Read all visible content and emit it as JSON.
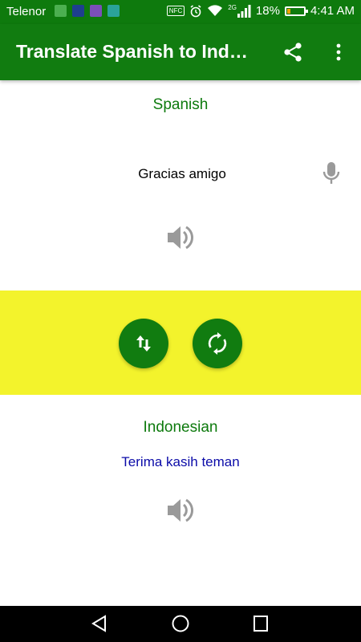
{
  "status_bar": {
    "carrier": "Telenor",
    "nfc": "NFC",
    "network": "2G",
    "battery_percent": "18%",
    "battery_level": 0.18,
    "time": "4:41 AM",
    "icons": [
      "cleaner-icon",
      "messenger-icon",
      "gallery-icon",
      "download-icon",
      "nfc-icon",
      "alarm-icon",
      "wifi-icon",
      "signal-icon",
      "battery-icon"
    ]
  },
  "app_bar": {
    "title": "Translate Spanish to Indonesian",
    "icons": [
      "share-icon",
      "more-vert-icon"
    ],
    "color": "#117c10"
  },
  "source": {
    "language": "Spanish",
    "input_value": "Gracias amigo",
    "icons": [
      "mic-icon",
      "speaker-icon"
    ]
  },
  "controls": {
    "background": "#f3f32c",
    "icons": [
      "swap-languages-icon",
      "refresh-icon"
    ]
  },
  "target": {
    "language": "Indonesian",
    "translation": "Terima kasih teman",
    "icons": [
      "speaker-icon"
    ]
  },
  "nav_bar": {
    "icons": [
      "back-icon",
      "home-icon",
      "recents-icon"
    ]
  }
}
